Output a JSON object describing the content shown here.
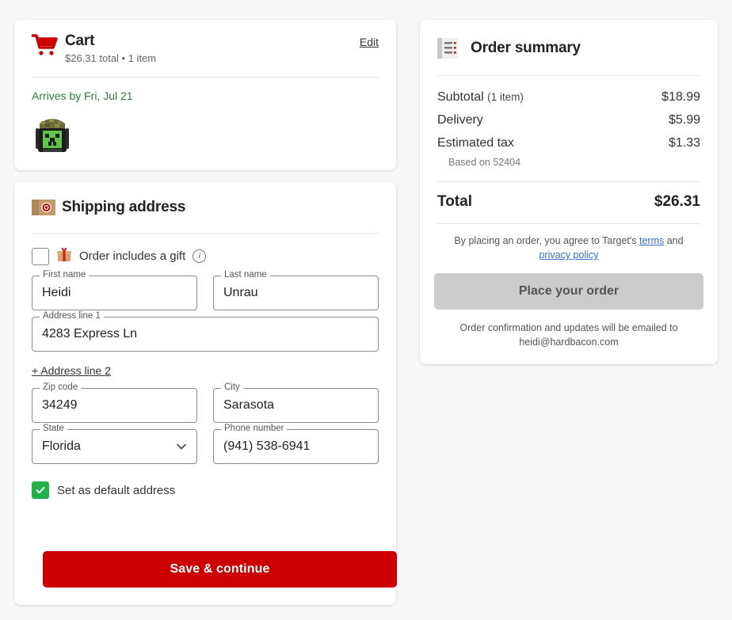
{
  "cart": {
    "icon": "shopping-cart-icon",
    "title": "Cart",
    "subtitle": "$26.31 total • 1 item",
    "edit_label": "Edit",
    "arrives": "Arrives by Fri, Jul 21",
    "product_alt": "minecraft-creeper-backpack"
  },
  "shipping": {
    "icon": "package-box-target-icon",
    "title": "Shipping address",
    "gift": {
      "icon": "gift-icon",
      "label": "Order includes a gift",
      "info_icon": "info-icon",
      "checked": false
    },
    "fields": {
      "first_name": {
        "label": "First name",
        "value": "Heidi"
      },
      "last_name": {
        "label": "Last name",
        "value": "Unrau"
      },
      "address1": {
        "label": "Address line 1",
        "value": "4283 Express Ln"
      },
      "address2_link": "+ Address line 2",
      "zip": {
        "label": "Zip code",
        "value": "34249"
      },
      "city": {
        "label": "City",
        "value": "Sarasota"
      },
      "state": {
        "label": "State",
        "value": "Florida",
        "icon": "chevron-down-icon"
      },
      "phone": {
        "label": "Phone number",
        "value": "(941) 538-6941"
      }
    },
    "default_address": {
      "label": "Set as default address",
      "checked": true
    },
    "save_label": "Save & continue"
  },
  "summary": {
    "icon": "receipt-list-icon",
    "title": "Order summary",
    "lines": [
      {
        "label": "Subtotal",
        "qty": "(1 item)",
        "amount": "$18.99",
        "note": ""
      },
      {
        "label": "Delivery",
        "qty": "",
        "amount": "$5.99",
        "note": ""
      },
      {
        "label": "Estimated tax",
        "qty": "",
        "amount": "$1.33",
        "note": "Based on 52404"
      }
    ],
    "total_label": "Total",
    "total_amount": "$26.31",
    "terms_prefix": "By placing an order, you agree to Target's ",
    "terms_link": "terms",
    "terms_mid": " and ",
    "privacy_link": "privacy policy",
    "place_order_label": "Place your order",
    "confirm_text": "Order confirmation and updates will be emailed to heidi@hardbacon.com"
  },
  "colors": {
    "brand_red": "#cc0000",
    "green_checkbox": "#21b14a",
    "delivery_green": "#2d7c3f",
    "link_blue": "#366cd8",
    "disabled_grey": "#cccccc"
  }
}
